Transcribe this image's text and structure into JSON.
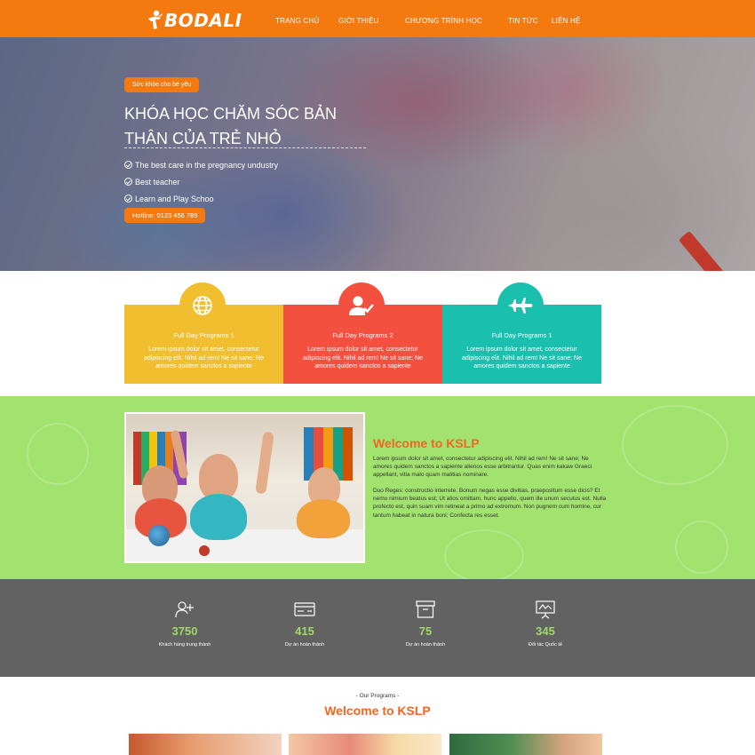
{
  "header": {
    "logo_text": "BODALI",
    "nav": [
      {
        "label": "TRANG CHỦ"
      },
      {
        "label": "GIỚI THIỆU"
      },
      {
        "label": "CHƯƠNG TRÌNH HỌC"
      },
      {
        "label": "TIN TỨC"
      },
      {
        "label": "LIÊN HỆ"
      }
    ],
    "bg_color": "#f47a10"
  },
  "hero": {
    "tag": "Sức khỏe cho bé yêu",
    "title": "KHÓA HỌC CHĂM SÓC BẢN THÂN CỦA TRẺ NHỎ",
    "checks": [
      "The best care in the pregnancy undustry",
      "Best teacher",
      "Learn and Play Schoo"
    ],
    "hotline": "Hotline: 0123 456 789"
  },
  "programs": [
    {
      "title": "Full Day Programs 1",
      "text": "Lorem ipsum dolor sit amet, consectetur adipiscing elit. Nihil ad rem! Ne sit sane; Ne amores quidem sanctos a sapiente",
      "color": "#f0be2e",
      "icon": "globe-icon"
    },
    {
      "title": "Full Day Programs 2",
      "text": "Lorem ipsum dolor sit amet, consectetur adipiscing elit. Nihil ad rem! Ne sit sane; Ne amores quidem sanctos a sapiente",
      "color": "#f4503f",
      "icon": "user-check-icon"
    },
    {
      "title": "Full Day Programs 1",
      "text": "Lorem ipsum dolor sit amet, consectetur adipiscing elit. Nihil ad rem! Ne sit sane; Ne amores quidem sanctos a sapiente",
      "color": "#1bbfae",
      "icon": "plane-icon"
    }
  ],
  "welcome": {
    "title": "Welcome to KSLP",
    "p1": "Lorem ipsum dolor sit amet, consectetur adipiscing elit. Nihil ad rem! Ne sit sane; Ne amores quidem sanctos a sapiente alienos esse arbitrantur. Quas enim kakaw Graeci appellant, vitia malo quam malitias nominare.",
    "p2": "Duo Reges: constructio interrete. Bonum negas esse divitias, praeposltum esse dicis? Et nemo nimium beatus est; Ut alios omittam, hunc appello, quem ille unum secutus est. Nulla profecto est, quin suam vim retineat a primo ad extremum. Non pugnem cum homine, cur tantum habeat in natura boni; Confecta res esset.",
    "bg_color": "#a2e36f"
  },
  "stats": [
    {
      "icon": "user-add-icon",
      "value": "3750",
      "label": "Khách hàng trung thành"
    },
    {
      "icon": "card-icon",
      "value": "415",
      "label": "Dự án hoàn thành"
    },
    {
      "icon": "archive-icon",
      "value": "75",
      "label": "Dự án hoàn thành"
    },
    {
      "icon": "presentation-icon",
      "value": "345",
      "label": "Đối tác Quốc tế"
    }
  ],
  "our_programs": {
    "subtitle": "- Our Programs -",
    "title": "Welcome to KSLP"
  }
}
